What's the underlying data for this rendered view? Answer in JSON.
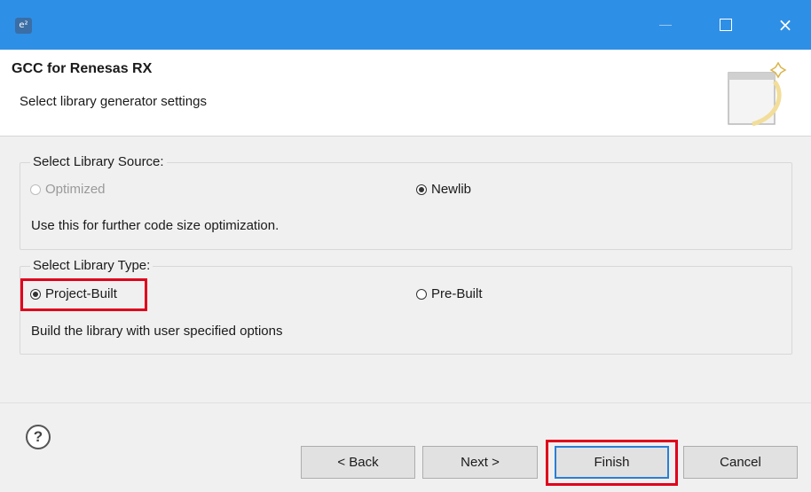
{
  "window": {
    "app_icon_text": "e²",
    "minimize_icon": "minimize-icon",
    "maximize_icon": "maximize-icon",
    "close_icon": "×"
  },
  "header": {
    "title": "GCC for Renesas RX",
    "subtitle": "Select library generator settings",
    "graphic": "wizard-banner-icon"
  },
  "library_source": {
    "legend": "Select Library Source:",
    "options": [
      {
        "label": "Optimized",
        "checked": false,
        "disabled": true
      },
      {
        "label": "Newlib",
        "checked": true,
        "disabled": false
      }
    ],
    "description": "Use this for further code size optimization."
  },
  "library_type": {
    "legend": "Select Library Type:",
    "options": [
      {
        "label": "Project-Built",
        "checked": true,
        "disabled": false
      },
      {
        "label": "Pre-Built",
        "checked": false,
        "disabled": false
      }
    ],
    "description": "Build the library with user specified options"
  },
  "footer": {
    "help_label": "?",
    "back_label": "< Back",
    "next_label": "Next >",
    "finish_label": "Finish",
    "cancel_label": "Cancel"
  },
  "colors": {
    "titlebar": "#2e8fe6",
    "highlight": "#e0001b",
    "default_button_border": "#2a7fd4"
  }
}
